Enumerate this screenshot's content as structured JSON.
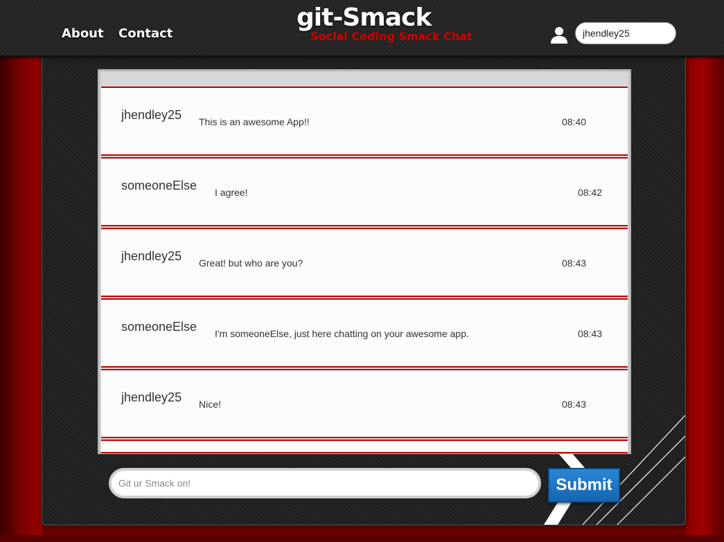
{
  "header": {
    "nav": [
      {
        "label": "About"
      },
      {
        "label": "Contact"
      }
    ],
    "brand_title": "git-Smack",
    "brand_tagline": "Social Coding Smack Chat",
    "username_value": "jhendley25"
  },
  "chat": {
    "messages": [
      {
        "user": "jhendley25",
        "text": "This is an awesome App!!",
        "time": "08:40"
      },
      {
        "user": "someoneElse",
        "text": "I agree!",
        "time": "08:42"
      },
      {
        "user": "jhendley25",
        "text": "Great! but who are you?",
        "time": "08:43"
      },
      {
        "user": "someoneElse",
        "text": "I'm someoneElse, just here chatting on your awesome app.",
        "time": "08:43"
      },
      {
        "user": "jhendley25",
        "text": "Nice!",
        "time": "08:43"
      }
    ]
  },
  "composer": {
    "placeholder": "Git ur Smack on!",
    "submit_label": "Submit"
  },
  "colors": {
    "accent_red": "#c40000",
    "submit_blue": "#1f78c8"
  },
  "icons": {
    "user": "user-icon"
  }
}
